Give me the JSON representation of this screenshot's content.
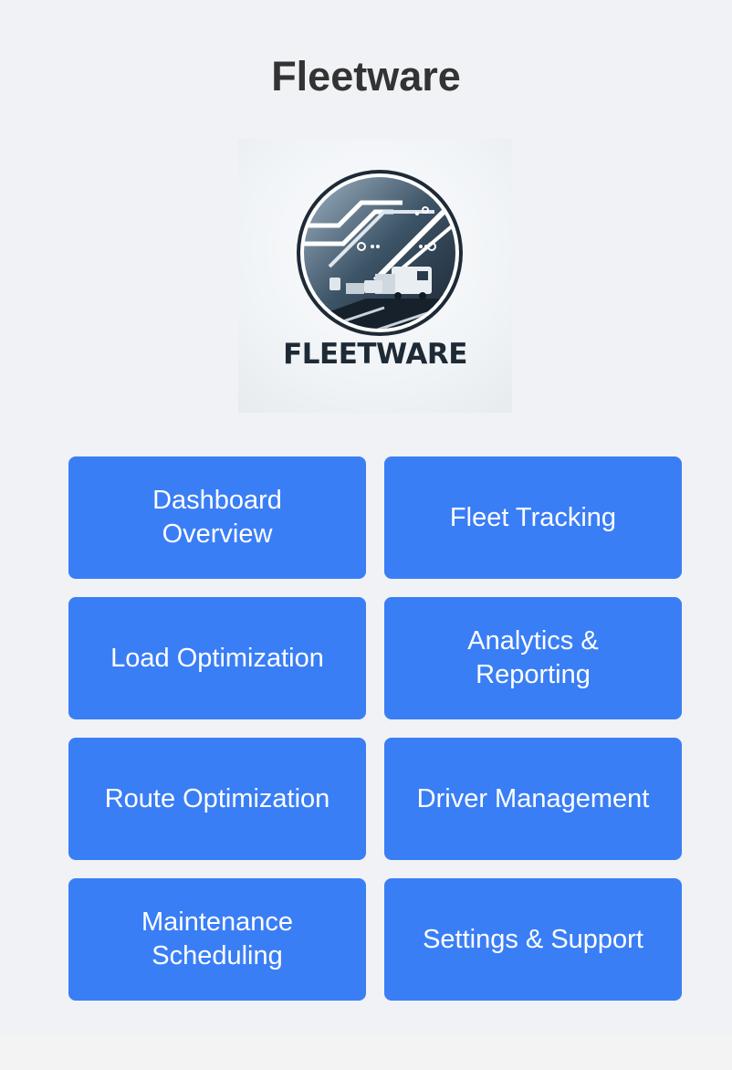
{
  "app": {
    "title": "Fleetware",
    "logo_text": "FLEETWARE"
  },
  "nav": {
    "buttons": [
      {
        "label": "Dashboard Overview"
      },
      {
        "label": "Fleet Tracking"
      },
      {
        "label": "Load Optimization"
      },
      {
        "label": "Analytics & Reporting"
      },
      {
        "label": "Route Optimization"
      },
      {
        "label": "Driver Management"
      },
      {
        "label": "Maintenance Scheduling"
      },
      {
        "label": "Settings & Support"
      }
    ]
  },
  "colors": {
    "background": "#f0f2f5",
    "button": "#3a7ef6",
    "button_text": "#ffffff",
    "title_text": "#333333"
  }
}
